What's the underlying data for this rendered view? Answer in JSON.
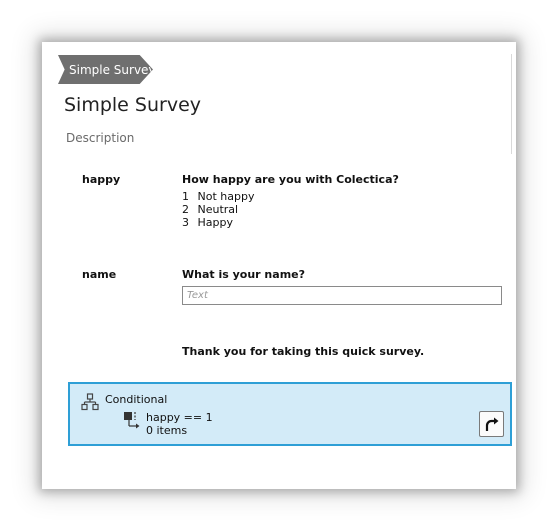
{
  "breadcrumb": {
    "label": "Simple Survey"
  },
  "survey": {
    "title": "Simple Survey",
    "description": "Description"
  },
  "questions": [
    {
      "name": "happy",
      "text": "How happy are you with Colectica?",
      "codes": [
        {
          "value": "1",
          "label": "Not happy"
        },
        {
          "value": "2",
          "label": "Neutral"
        },
        {
          "value": "3",
          "label": "Happy"
        }
      ]
    },
    {
      "name": "name",
      "text": "What is your name?",
      "input_placeholder": "Text"
    }
  ],
  "statement": "Thank you for taking this quick survey.",
  "conditional": {
    "label": "Conditional",
    "expression": "happy == 1",
    "items_count": "0 items",
    "button_icon": "redo-arrow-icon",
    "colors": {
      "background": "#d3ebf8",
      "border": "#2e9fd6"
    }
  }
}
